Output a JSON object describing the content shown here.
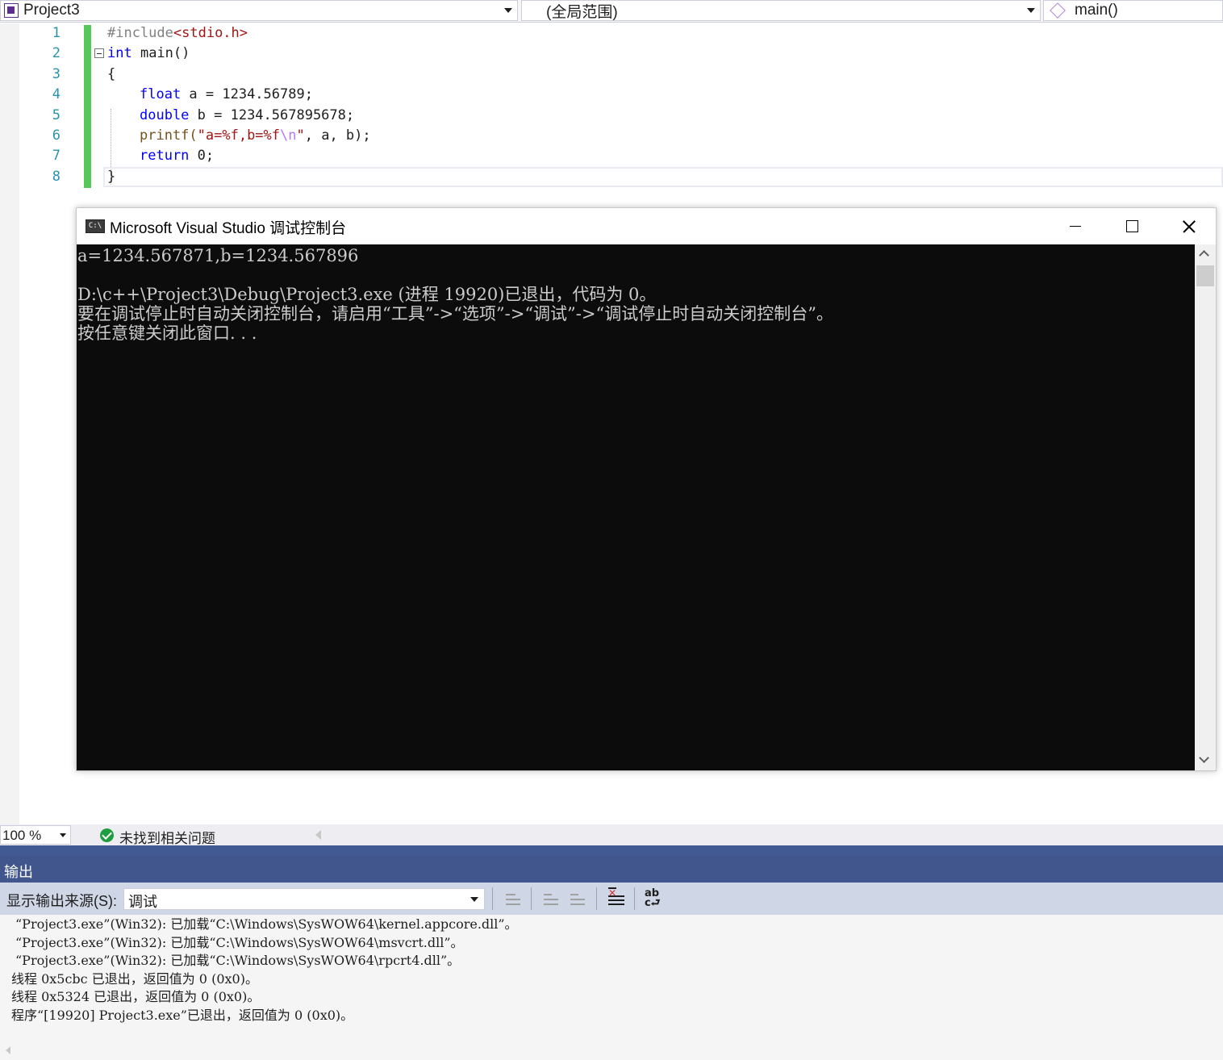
{
  "nav": {
    "project": "Project3",
    "scope": "(全局范围)",
    "member": "main()"
  },
  "editor": {
    "line_numbers": [
      "1",
      "2",
      "3",
      "4",
      "5",
      "6",
      "7",
      "8"
    ],
    "code": {
      "l1_directive": "#include",
      "l1_header": "<stdio.h>",
      "l2_kw": "int",
      "l2_rest": " main()",
      "l3": "{",
      "l4_kw": "float",
      "l4_rest": " a = 1234.56789;",
      "l5_kw": "double",
      "l5_rest": " b = 1234.567895678;",
      "l6_fn": "printf(",
      "l6_str": "\"a=%f,b=%f",
      "l6_esc": "\\n",
      "l6_strend": "\"",
      "l6_rest": ", a, b);",
      "l7_kw": "return",
      "l7_rest": " 0;",
      "l8": "}"
    }
  },
  "console": {
    "title": "Microsoft Visual Studio 调试控制台",
    "icon_text": "C:\\",
    "lines": [
      "a=1234.567871,b=1234.567896",
      "",
      "D:\\c++\\Project3\\Debug\\Project3.exe (进程 19920)已退出，代码为 0。",
      "要在调试停止时自动关闭控制台，请启用“工具”->“选项”->“调试”->“调试停止时自动关闭控制台”。",
      "按任意键关闭此窗口. . ."
    ]
  },
  "status": {
    "zoom": "100 %",
    "issues": "未找到相关问题"
  },
  "output": {
    "title": "输出",
    "source_label": "显示输出来源(S):",
    "source_value": "调试",
    "lines": [
      "“Project3.exe”(Win32): 已加载“C:\\Windows\\SysWOW64\\kernel.appcore.dll”。",
      "“Project3.exe”(Win32): 已加载“C:\\Windows\\SysWOW64\\msvcrt.dll”。",
      "“Project3.exe”(Win32): 已加载“C:\\Windows\\SysWOW64\\rpcrt4.dll”。",
      "线程 0x5cbc 已退出，返回值为 0 (0x0)。",
      "线程 0x5324 已退出，返回值为 0 (0x0)。",
      "程序“[19920] Project3.exe”已退出，返回值为 0 (0x0)。"
    ]
  },
  "colors": {
    "keyword": "#0000ff",
    "string": "#a31515",
    "line_number": "#2b91af",
    "change_bar": "#57c75a",
    "output_header": "#40568d",
    "console_bg": "#0c0c0c"
  },
  "icons": [
    "project-icon",
    "cube-icon",
    "console-app-icon",
    "minimize-icon",
    "maximize-icon",
    "close-icon",
    "check-circle-icon",
    "clear-all-icon",
    "word-wrap-icon"
  ]
}
